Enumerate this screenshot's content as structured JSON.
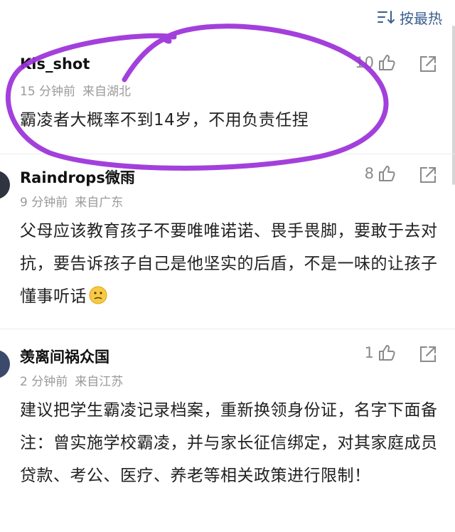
{
  "header": {
    "sort_label": "按最热"
  },
  "comments": [
    {
      "username": "Kis_shot",
      "time": "15 分钟前",
      "location": "来自湖北",
      "likes": "10",
      "text": "霸凌者大概率不到14岁，不用负责任捏"
    },
    {
      "username": "Raindrops微雨",
      "time": "9 分钟前",
      "location": "来自广东",
      "likes": "8",
      "text": "父母应该教育孩子不要唯唯诺诺、畏手畏脚，要敢于去对抗，要告诉孩子自己是他坚实的后盾，不是一味的让孩子懂事听话"
    },
    {
      "username": "羡离间祸众国",
      "time": "2 分钟前",
      "location": "来自江苏",
      "likes": "1",
      "text": "建议把学生霸凌记录档案，重新换领身份证，名字下面备注：曾实施学校霸凌，并与家长征信绑定，对其家庭成员贷款、考公、医疗、养老等相关政策进行限制！"
    }
  ],
  "colors": {
    "annotation": "#9b30d9",
    "accent": "#3a5f8f",
    "meta": "#9a9a9a"
  }
}
